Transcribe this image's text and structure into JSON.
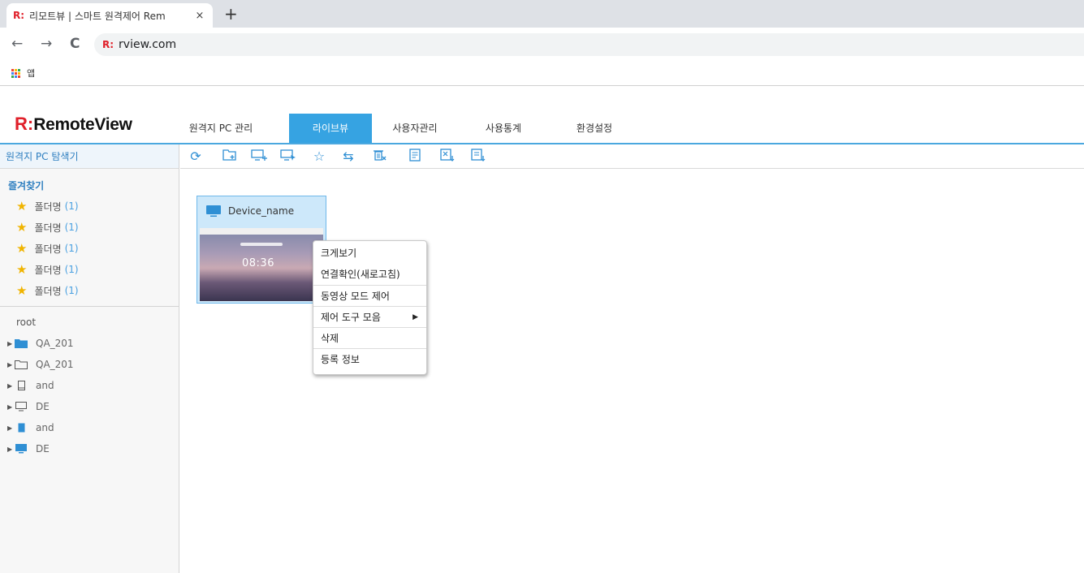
{
  "browser": {
    "tab_favicon": "R:",
    "tab_title": "리모트뷰 | 스마트 원격제어 Rem",
    "tab_close": "×",
    "new_tab": "+",
    "back": "←",
    "forward": "→",
    "reload": "C",
    "url_favicon": "R:",
    "url": "rview.com",
    "bookmark_apps_label": "앱"
  },
  "app": {
    "logo_mark": "R:",
    "logo_text": "RemoteView",
    "menu": [
      {
        "label": "원격지 PC 관리",
        "active": false
      },
      {
        "label": "라이브뷰",
        "active": true
      },
      {
        "label": "사용자관리",
        "active": false
      },
      {
        "label": "사용통계",
        "active": false
      },
      {
        "label": "환경설정",
        "active": false
      }
    ],
    "accent_color": "#36a3e2"
  },
  "sidebar": {
    "header": "원격지 PC 탐색기",
    "favorites_title": "즐겨찾기",
    "favorites": [
      {
        "label": "폴더명",
        "count": "(1)"
      },
      {
        "label": "폴더명",
        "count": "(1)"
      },
      {
        "label": "폴더명",
        "count": "(1)"
      },
      {
        "label": "폴더명",
        "count": "(1)"
      },
      {
        "label": "폴더명",
        "count": "(1)"
      }
    ],
    "root_label": "root",
    "tree": [
      {
        "label": "QA_201",
        "icon": "folder-filled-icon"
      },
      {
        "label": "QA_201",
        "icon": "folder-outline-icon"
      },
      {
        "label": "and",
        "icon": "tablet-outline-icon"
      },
      {
        "label": "DE",
        "icon": "monitor-outline-icon"
      },
      {
        "label": "and",
        "icon": "tablet-filled-icon"
      },
      {
        "label": "DE",
        "icon": "monitor-filled-icon"
      }
    ]
  },
  "toolbar_icons": [
    "refresh-icon",
    "add-folder-icon",
    "add-pc-icon",
    "connect-pc-icon",
    "add-favorite-icon",
    "move-icon",
    "delete-icon",
    "list-icon",
    "excel-export-icon",
    "import-icon"
  ],
  "device": {
    "name": "Device_name",
    "thumbnail_time": "08:36"
  },
  "context_menu": {
    "items": [
      "크게보기",
      "연결확인(새로고침)",
      "동영상 모드 제어",
      "제어 도구 모음",
      "삭제",
      "등록 정보"
    ],
    "submenu_arrow": "▶"
  }
}
